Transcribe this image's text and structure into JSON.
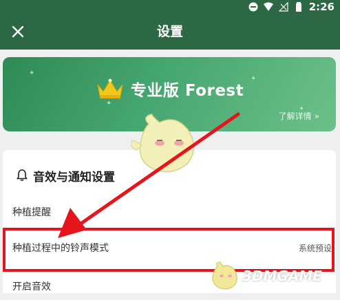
{
  "status_bar": {
    "time": "2:26"
  },
  "app_bar": {
    "title": "设置",
    "close_icon": "close-icon"
  },
  "banner": {
    "title": "专业版 Forest",
    "link_label": "了解详情",
    "link_arrow": "»"
  },
  "settings": {
    "section_title": "音效与通知设置",
    "rows": [
      {
        "label": "种植提醒",
        "value": ""
      },
      {
        "label": "种植过程中的铃声模式",
        "value": "系统预设"
      },
      {
        "label": "开启音效",
        "value": ""
      }
    ]
  },
  "watermark": {
    "text": "3DMGAME"
  },
  "colors": {
    "app_bar": "#2d6844",
    "banner": "#46a670",
    "highlight": "#e6141c",
    "crown": "#f2c81c"
  }
}
